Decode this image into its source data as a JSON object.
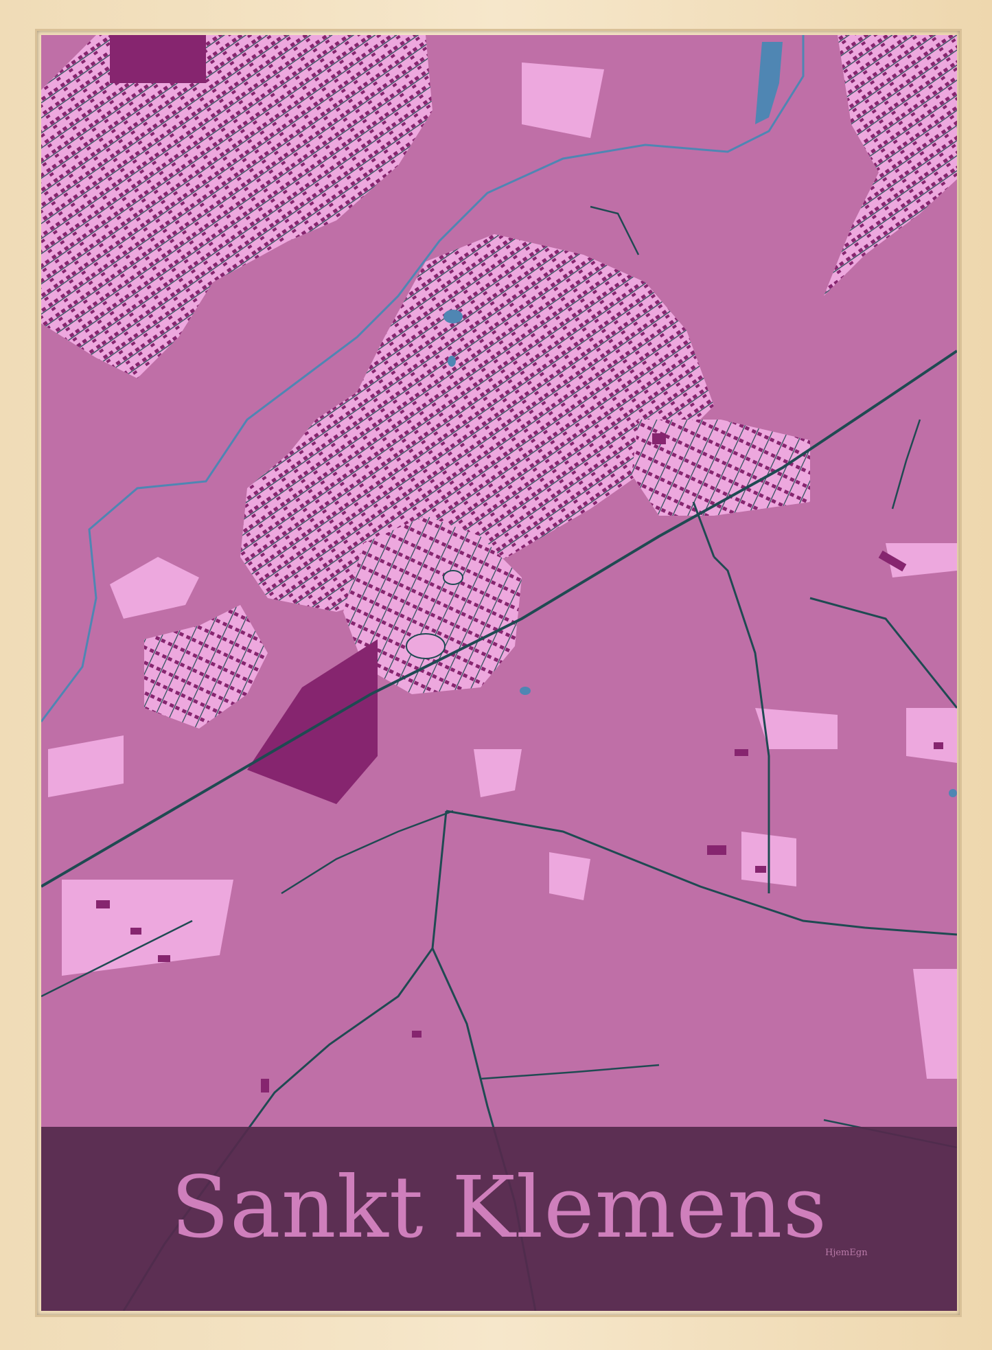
{
  "poster": {
    "city_name": "Sankt Klemens",
    "brand": "HjemEgn"
  },
  "colors": {
    "background": "#bf6fa7",
    "residential": "#eda8de",
    "buildings": "#86256f",
    "roads": "#1f4a52",
    "water": "#4f86b3",
    "title_band": "#542a4c",
    "title_text": "#cf7fbc",
    "frame": "#f3e2c2"
  }
}
